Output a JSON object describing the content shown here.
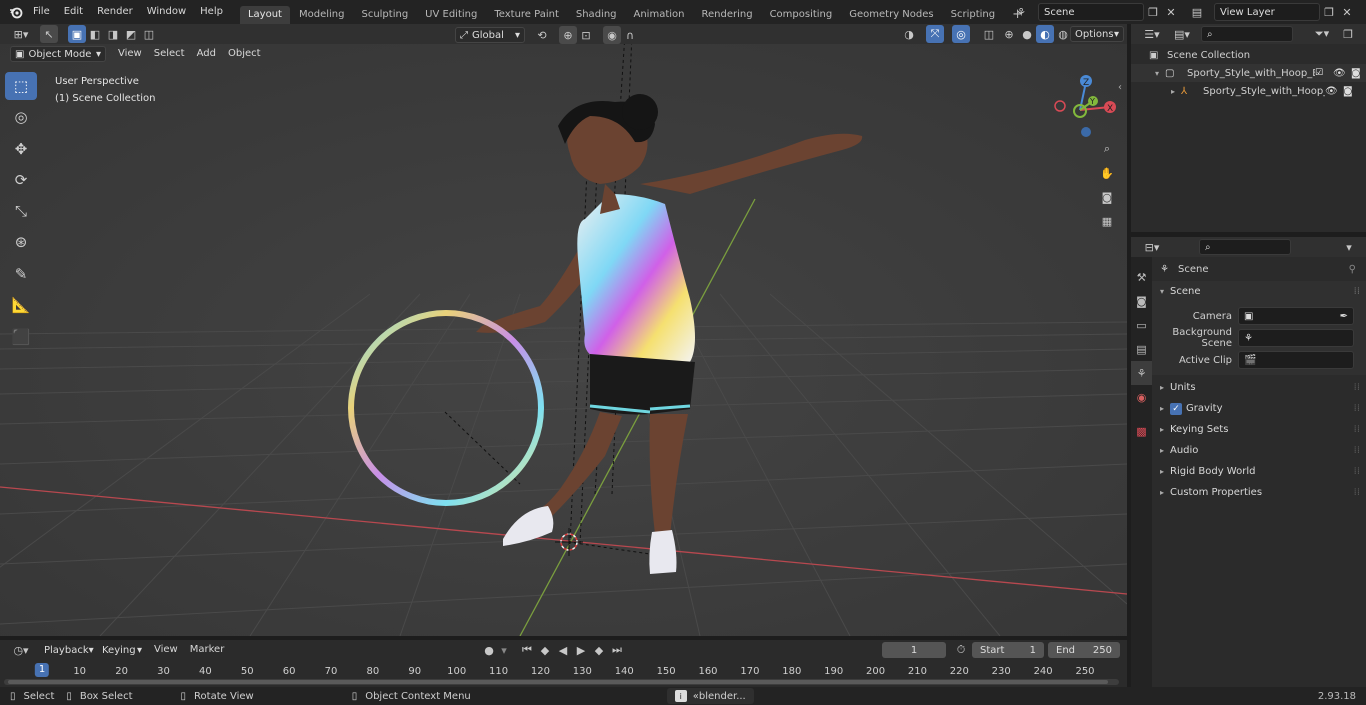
{
  "menu": {
    "items": [
      "File",
      "Edit",
      "Render",
      "Window",
      "Help"
    ]
  },
  "workspaces": [
    "Layout",
    "Modeling",
    "Sculpting",
    "UV Editing",
    "Texture Paint",
    "Shading",
    "Animation",
    "Rendering",
    "Compositing",
    "Geometry Nodes",
    "Scripting"
  ],
  "active_workspace": "Layout",
  "scene_field": "Scene",
  "view_layer_field": "View Layer",
  "viewport": {
    "mode": "Object Mode",
    "menus": [
      "View",
      "Select",
      "Add",
      "Object"
    ],
    "transform_orientation": "Global",
    "options": "Options",
    "overlay_title": "User Perspective",
    "overlay_subtitle": "(1) Scene Collection"
  },
  "gizmo": {
    "x": "X",
    "y": "Y",
    "z": "Z"
  },
  "outliner": {
    "root": "Scene Collection",
    "items": [
      "Sporty_Style_with_Hoop_Blac",
      "Sporty_Style_with_Hoop_"
    ]
  },
  "properties": {
    "context": "Scene",
    "panel": "Scene",
    "fields": [
      {
        "label": "Camera"
      },
      {
        "label": "Background Scene"
      },
      {
        "label": "Active Clip"
      }
    ],
    "sections": [
      "Units",
      "Gravity",
      "Keying Sets",
      "Audio",
      "Rigid Body World",
      "Custom Properties"
    ],
    "gravity_enabled": true
  },
  "timeline": {
    "menus": [
      "Playback",
      "Keying",
      "View",
      "Marker"
    ],
    "current_frame": "1",
    "start_label": "Start",
    "start": "1",
    "end_label": "End",
    "end": "250",
    "ticks": [
      "1",
      "10",
      "20",
      "30",
      "40",
      "50",
      "60",
      "70",
      "80",
      "90",
      "100",
      "110",
      "120",
      "130",
      "140",
      "150",
      "160",
      "170",
      "180",
      "190",
      "200",
      "210",
      "220",
      "230",
      "240",
      "250"
    ]
  },
  "status": {
    "select": "Select",
    "box_select": "Box Select",
    "rotate_view": "Rotate View",
    "context_menu": "Object Context Menu",
    "task": "«blender...",
    "version": "2.93.18"
  },
  "colors": {
    "accent": "#4772b3",
    "x_axis": "#d84a55",
    "y_axis": "#82b83c",
    "z_axis": "#4a8ad6"
  }
}
